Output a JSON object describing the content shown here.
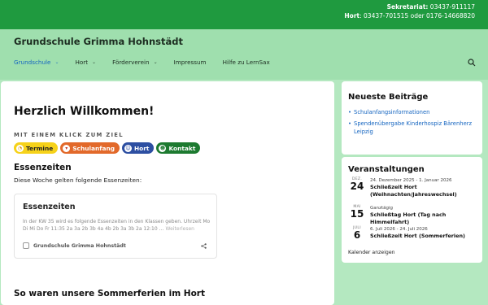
{
  "topbar": {
    "secretariat_label": "Sekretariat:",
    "secretariat_phone": "03437-911117",
    "hort_label": "Hort",
    "hort_phones": ": 03437-701515 oder 0176-14668820"
  },
  "header": {
    "site_title": "Grundschule Grimma Hohnstädt",
    "nav": [
      {
        "label": "Grundschule",
        "has_dropdown": true
      },
      {
        "label": "Hort",
        "has_dropdown": true
      },
      {
        "label": "Förderverein",
        "has_dropdown": true
      },
      {
        "label": "Impressum",
        "has_dropdown": false
      },
      {
        "label": "Hilfe zu LernSax",
        "has_dropdown": false
      }
    ],
    "search_icon": "search-icon"
  },
  "main": {
    "welcome": "Herzlich Willkommen!",
    "quick_label": "MIT EINEM KLICK ZUM ZIEL",
    "quick_links": [
      {
        "label": "Termine",
        "icon": "clock-icon"
      },
      {
        "label": "Schulanfang",
        "icon": "cone-icon"
      },
      {
        "label": "Hort",
        "icon": "kids-icon"
      },
      {
        "label": "Kontakt",
        "icon": "contact-icon"
      }
    ],
    "essen_heading": "Essenzeiten",
    "essen_sub": "Diese Woche gelten folgende Essenzeiten:",
    "card": {
      "title": "Essenzeiten",
      "text": "In der KW 35 wird es folgende Essenzeiten in den Klassen geben.  Uhrzeit Mo Di Mi Do Fr 11:35 2a 3a 2b 3b 4a 4b 2b 3a 3b 2a 12:10 …",
      "more": "Weiterlesen",
      "footer": "Grundschule Grimma Hohnstädt"
    },
    "summer_heading": "So waren unsere Sommerferien im Hort"
  },
  "sidebar": {
    "news_title": "Neueste Beiträge",
    "news_items": [
      "Schulanfangsinformationen",
      "Spendenübergabe Kinderhospiz Bärenherz Leipzig"
    ],
    "events_title": "Veranstaltungen",
    "events": [
      {
        "month": "DEZ.",
        "day": "24",
        "range": "24. Dezember 2025 - 1. Januar 2026",
        "title": "Schließzeit Hort (Weihnachten/Jahreswechsel)"
      },
      {
        "month": "MAI",
        "day": "15",
        "range": "Ganztägig",
        "title": "Schließtag Hort (Tag nach Himmelfahrt)"
      },
      {
        "month": "JULI",
        "day": "6",
        "range": "6. Juli 2026 - 24. Juli 2026",
        "title": "Schließzeit Hort (Sommerferien)"
      }
    ],
    "calendar_link": "Kalender anzeigen"
  }
}
